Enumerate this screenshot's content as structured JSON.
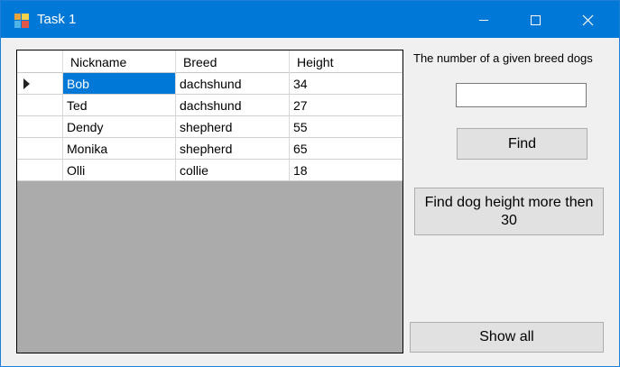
{
  "window": {
    "title": "Task 1"
  },
  "grid": {
    "columns": [
      "Nickname",
      "Breed",
      "Height"
    ],
    "rows": [
      {
        "nickname": "Bob",
        "breed": "dachshund",
        "height": "34"
      },
      {
        "nickname": "Ted",
        "breed": "dachshund",
        "height": "27"
      },
      {
        "nickname": "Dendy",
        "breed": "shepherd",
        "height": "55"
      },
      {
        "nickname": "Monika",
        "breed": "shepherd",
        "height": "65"
      },
      {
        "nickname": "Olli",
        "breed": "collie",
        "height": "18"
      }
    ],
    "selected_row": 0
  },
  "panel": {
    "count_label": "The number of a given breed dogs",
    "breed_input_value": "",
    "find_label": "Find",
    "height_label": "Find dog height more then 30",
    "show_all_label": "Show all"
  },
  "colors": {
    "titlebar": "#0078d7",
    "selection": "#0078d7",
    "grid_background": "#ababab"
  }
}
